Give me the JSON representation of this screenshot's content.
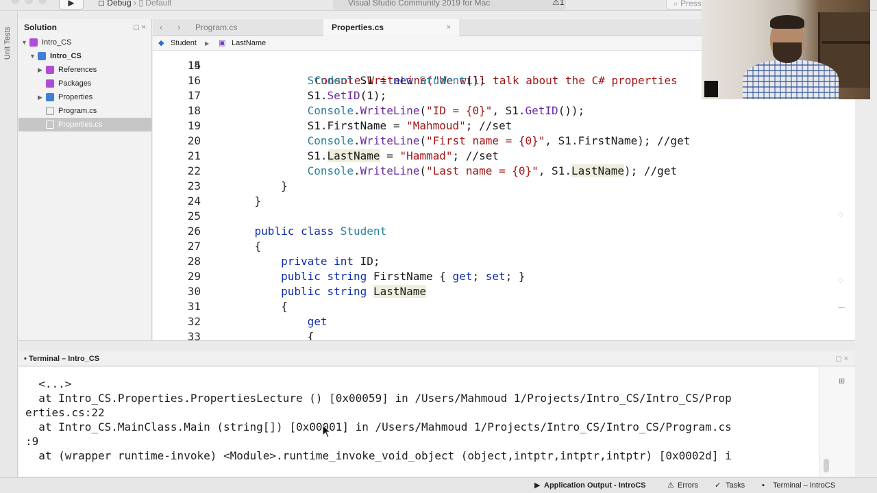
{
  "toolbar": {
    "run_label": "▶",
    "config_debug": "Debug",
    "config_separator": "›",
    "config_target": "Default",
    "title": "Visual Studio Community 2019 for Mac",
    "warning": "⚠1",
    "search_placeholder": "Press '⌘.' to search"
  },
  "vertical_strip": {
    "label": "Unit Tests"
  },
  "solution": {
    "header": "Solution",
    "header_icons": "◻ ×",
    "tree": [
      {
        "label": "Intro_CS",
        "level": 0,
        "expanded": true,
        "selected": false,
        "bold": false
      },
      {
        "label": "Intro_CS",
        "level": 1,
        "expanded": true,
        "selected": false,
        "bold": true
      },
      {
        "label": "References",
        "level": 2,
        "expanded": false,
        "selected": false,
        "bold": false
      },
      {
        "label": "Packages",
        "level": 2,
        "expanded": false,
        "selected": false,
        "bold": false
      },
      {
        "label": "Properties",
        "level": 2,
        "expanded": false,
        "selected": false,
        "bold": false
      },
      {
        "label": "Program.cs",
        "level": 2,
        "expanded": false,
        "selected": false,
        "bold": false
      },
      {
        "label": "Properties.cs",
        "level": 2,
        "expanded": false,
        "selected": true,
        "bold": false
      }
    ]
  },
  "editor": {
    "tabs": [
      {
        "label": "Program.cs",
        "active": false
      },
      {
        "label": "Properties.cs",
        "active": true
      }
    ],
    "tab_close": "×",
    "breadcrumb": {
      "class": "Student",
      "separator": "▶",
      "member": "LastName"
    },
    "top_partial_line": "Console.WriteLine(\"We will talk about the C# properties",
    "line_numbers": [
      "15",
      "16",
      "17",
      "18",
      "19",
      "20",
      "21",
      "22",
      "23",
      "24",
      "25",
      "26",
      "27",
      "28",
      "29",
      "30",
      "31",
      "32",
      "33"
    ]
  },
  "terminal": {
    "title": "Terminal – Intro_CS",
    "header_icons": "◻ ×",
    "lines": [
      "  <...>",
      "  at Intro_CS.Properties.PropertiesLecture () [0x00059] in /Users/Mahmoud 1/Projects/Intro_CS/Intro_CS/Prop",
      "erties.cs:22",
      "  at Intro_CS.MainClass.Main (string[]) [0x00001] in /Users/Mahmoud 1/Projects/Intro_CS/Intro_CS/Program.cs",
      ":9",
      "  at (wrapper runtime-invoke) <Module>.runtime_invoke_void_object (object,intptr,intptr,intptr) [0x0002d] i"
    ]
  },
  "statusbar": {
    "app_output": "Application Output - IntroCS",
    "errors": "Errors",
    "tasks": "Tasks",
    "terminal": "Terminal – IntroCS"
  },
  "colors": {
    "keyword": "#0b2dad",
    "type": "#2a7f9e",
    "string": "#a31515",
    "selection": "#c6c6c6",
    "active_tab": "#f7f7f7"
  }
}
